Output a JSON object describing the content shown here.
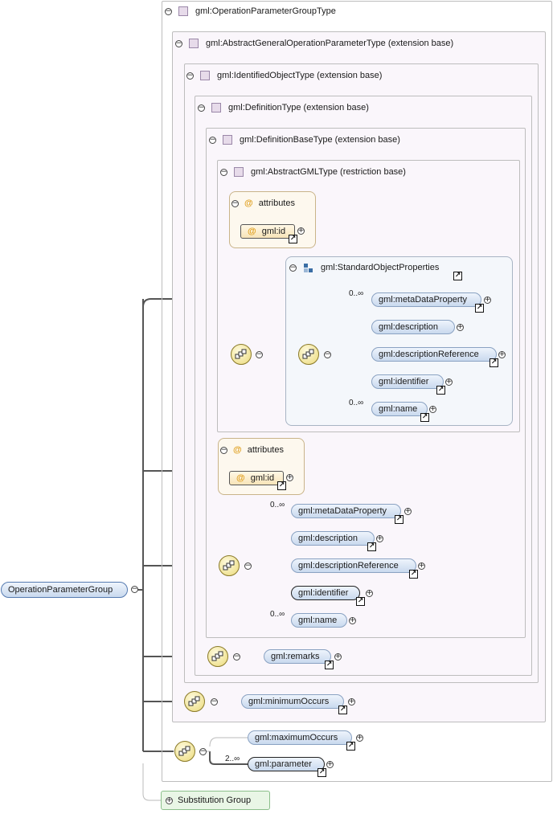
{
  "root": {
    "label": "OperationParameterGroup"
  },
  "types": {
    "operation_parameter_group_type": "gml:OperationParameterGroupType",
    "abstract_general": "gml:AbstractGeneralOperationParameterType (extension base)",
    "identified_object": "gml:IdentifiedObjectType (extension base)",
    "definition": "gml:DefinitionType (extension base)",
    "definition_base": "gml:DefinitionBaseType (extension base)",
    "abstract_gml": "gml:AbstractGMLType (restriction base)"
  },
  "attributes_label": "attributes",
  "attribute_gml_id": "gml:id",
  "standard_object_properties": {
    "title": "gml:StandardObjectProperties",
    "elements": [
      {
        "label": "gml:metaDataProperty",
        "card": "0..∞"
      },
      {
        "label": "gml:description",
        "card": ""
      },
      {
        "label": "gml:descriptionReference",
        "card": ""
      },
      {
        "label": "gml:identifier",
        "card": ""
      },
      {
        "label": "gml:name",
        "card": "0..∞"
      }
    ]
  },
  "definition_sequence": [
    {
      "label": "gml:metaDataProperty",
      "card": "0..∞"
    },
    {
      "label": "gml:description",
      "card": ""
    },
    {
      "label": "gml:descriptionReference",
      "card": ""
    },
    {
      "label": "gml:identifier",
      "card": ""
    },
    {
      "label": "gml:name",
      "card": "0..∞"
    }
  ],
  "remarks": "gml:remarks",
  "minimum_occurs": "gml:minimumOccurs",
  "maximum_occurs": "gml:maximumOccurs",
  "parameter": {
    "label": "gml:parameter",
    "card": "2..∞"
  },
  "substitution_group": "Substitution Group",
  "icons": {
    "expand": "plus-icon",
    "collapse": "minus-icon",
    "link": "arrow-link-icon",
    "sequence": "sequence-compositor-icon",
    "attribute": "at-icon",
    "type": "type-square-icon"
  },
  "colors": {
    "element_fill": "#c9d9ee",
    "compositor_fill": "#ead978",
    "attribute_fill": "#fdf8ee",
    "substitution_fill": "#e9f6e6"
  }
}
